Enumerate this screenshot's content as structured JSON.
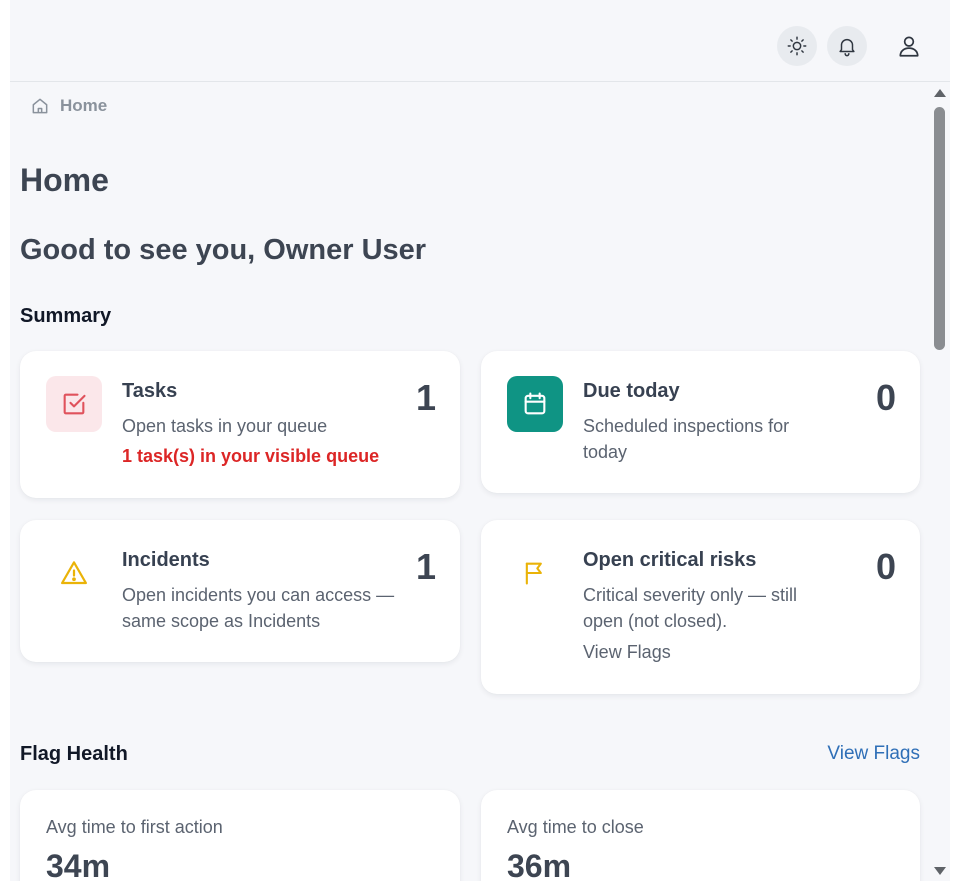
{
  "header": {
    "theme_icon": "sun-icon",
    "notifications_icon": "bell-icon",
    "profile_icon": "user-icon"
  },
  "breadcrumb": {
    "icon": "home-icon",
    "label": "Home"
  },
  "page": {
    "title": "Home",
    "greeting": "Good to see you, Owner User"
  },
  "summary": {
    "title": "Summary",
    "cards": [
      {
        "title": "Tasks",
        "count": "1",
        "description": "Open tasks in your queue",
        "note": "1 task(s) in your visible queue",
        "icon": "checkbox-icon",
        "icon_color": "#e0525c",
        "icon_bg": "#fbe7ea"
      },
      {
        "title": "Due today",
        "count": "0",
        "description": "Scheduled inspections for today",
        "icon": "calendar-icon",
        "icon_color": "#ffffff",
        "icon_bg": "#0f9484"
      },
      {
        "title": "Incidents",
        "count": "1",
        "description": "Open incidents you can access — same scope as Incidents",
        "icon": "warning-icon",
        "icon_color": "#eab308"
      },
      {
        "title": "Open critical risks",
        "count": "0",
        "description": "Critical severity only — still open (not closed).",
        "link": "View Flags",
        "icon": "flag-icon",
        "icon_color": "#eab308"
      }
    ]
  },
  "flag_health": {
    "title": "Flag Health",
    "view_link": "View Flags",
    "metrics": [
      {
        "label": "Avg time to first action",
        "value": "34m"
      },
      {
        "label": "Avg time to close",
        "value": "36m"
      }
    ]
  }
}
